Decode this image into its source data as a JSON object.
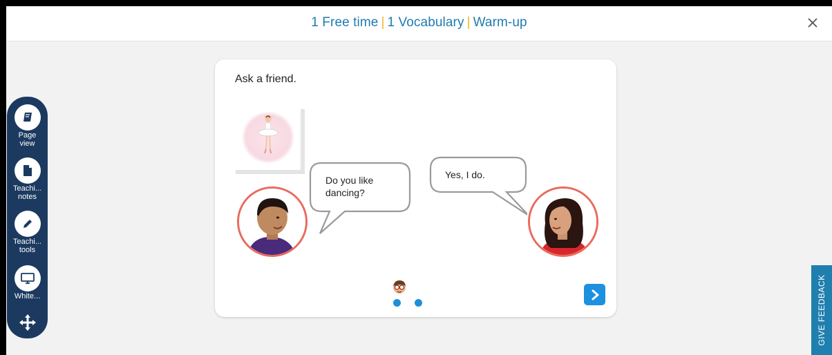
{
  "header": {
    "breadcrumb": [
      "1 Free time",
      "1 Vocabulary",
      "Warm-up"
    ],
    "separator": "|",
    "close_icon": "close-icon"
  },
  "toolbar": {
    "items": [
      {
        "label": "Page\nview",
        "icon": "book-icon"
      },
      {
        "label": "Teachi...\nnotes",
        "icon": "document-icon"
      },
      {
        "label": "Teachi...\ntools",
        "icon": "pencil-icon"
      },
      {
        "label": "White...",
        "icon": "monitor-icon"
      }
    ],
    "move_icon": "move-arrows-icon"
  },
  "activity": {
    "instruction": "Ask a friend.",
    "question_bubble": "Do you like\ndancing?",
    "answer_bubble": "Yes, I do.",
    "picture": "ballerina",
    "pagination": {
      "current": 1,
      "total": 2
    },
    "next_icon": "chevron-right-icon"
  },
  "feedback": {
    "label": "GIVE FEEDBACK"
  },
  "colors": {
    "brand_blue": "#1f7bb0",
    "separator_gold": "#f0b429",
    "toolbar_navy": "#1c3a60",
    "avatar_ring": "#e96a5d",
    "button_blue": "#1e90e0"
  }
}
